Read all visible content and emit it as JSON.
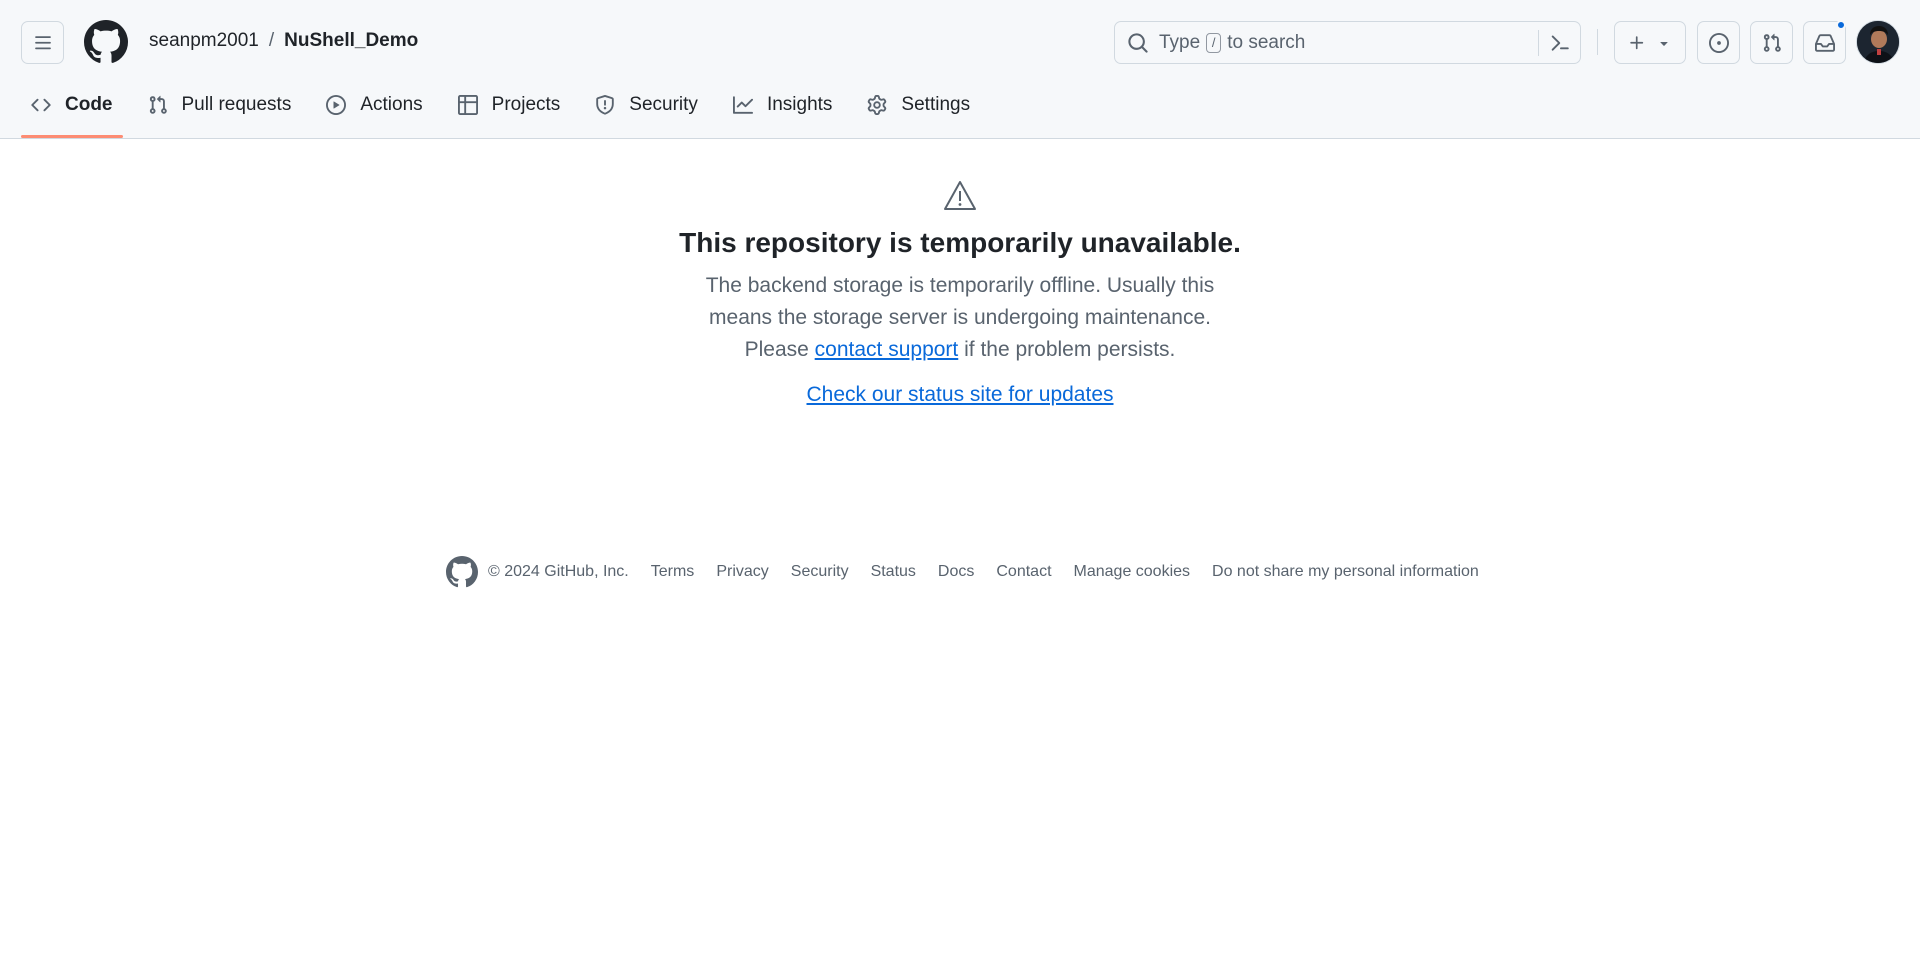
{
  "header": {
    "owner": "seanpm2001",
    "separator": "/",
    "repo": "NuShell_Demo",
    "search": {
      "type_label": "Type",
      "key": "/",
      "to_search_label": "to search"
    }
  },
  "tabs": [
    {
      "label": "Code",
      "icon": "code-icon",
      "active": true
    },
    {
      "label": "Pull requests",
      "icon": "git-pull-request-icon"
    },
    {
      "label": "Actions",
      "icon": "play-icon"
    },
    {
      "label": "Projects",
      "icon": "table-icon"
    },
    {
      "label": "Security",
      "icon": "shield-icon"
    },
    {
      "label": "Insights",
      "icon": "graph-icon"
    },
    {
      "label": "Settings",
      "icon": "gear-icon"
    }
  ],
  "main": {
    "title": "This repository is temporarily unavailable.",
    "desc_line1": "The backend storage is temporarily offline. Usually this",
    "desc_line2": "means the storage server is undergoing maintenance.",
    "desc_please": "Please",
    "desc_link": "contact support",
    "desc_after": "if the problem persists.",
    "status_link": "Check our status site for updates"
  },
  "footer": {
    "copyright": "© 2024 GitHub, Inc.",
    "links": [
      "Terms",
      "Privacy",
      "Security",
      "Status",
      "Docs",
      "Contact",
      "Manage cookies",
      "Do not share my personal information"
    ]
  },
  "colors": {
    "accent": "#0969da",
    "tab_underline": "#fd8c73",
    "notification_dot": "#0969da"
  }
}
